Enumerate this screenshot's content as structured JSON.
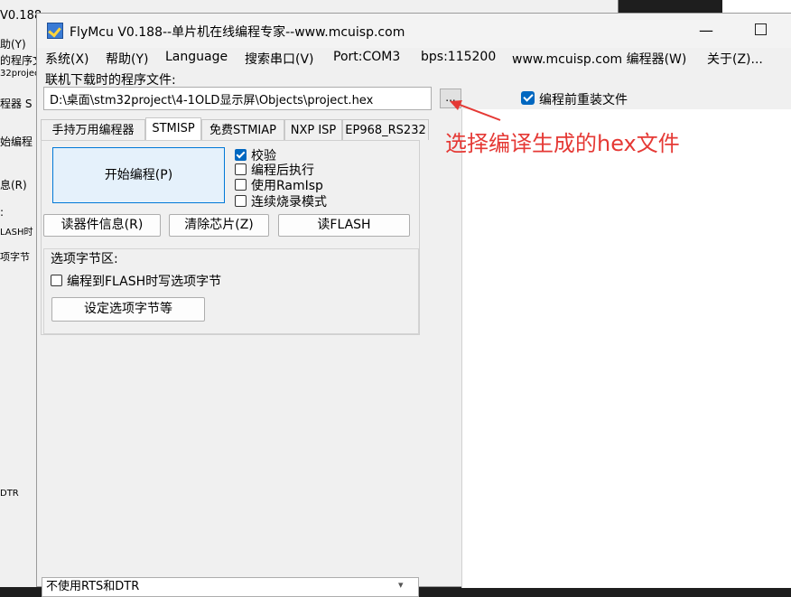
{
  "background_window": {
    "title": "V0.188-",
    "lines": [
      "助(Y)",
      "的程序文",
      "32projec",
      "程器 S",
      "始编程",
      "息(R)",
      ":",
      "LASH时",
      "项字节",
      "DTR"
    ]
  },
  "window": {
    "title": "FlyMcu V0.188--单片机在线编程专家--www.mcuisp.com",
    "minimize": "—"
  },
  "menu": [
    "系统(X)",
    "帮助(Y)",
    "Language",
    "搜索串口(V)",
    "Port:COM3",
    "bps:115200",
    "www.mcuisp.com 编程器(W)",
    "关于(Z)..."
  ],
  "file": {
    "label": "联机下载时的程序文件:",
    "path": "D:\\桌面\\stm32project\\4-1OLD显示屏\\Objects\\project.hex",
    "browse": "...",
    "reload_label": "编程前重装文件",
    "reload_checked": true
  },
  "tabs": [
    "手持万用编程器",
    "STMISP",
    "免费STMIAP",
    "NXP ISP",
    "EP968_RS232"
  ],
  "active_tab": "STMISP",
  "stmisp": {
    "start_button": "开始编程(P)",
    "options": [
      {
        "label": "校验",
        "checked": true
      },
      {
        "label": "编程后执行",
        "checked": false
      },
      {
        "label": "使用RamIsp",
        "checked": false
      },
      {
        "label": "连续烧录模式",
        "checked": false
      }
    ],
    "read_info": "读器件信息(R)",
    "erase_chip": "清除芯片(Z)",
    "read_flash": "读FLASH",
    "option_bytes": {
      "title": "选项字节区:",
      "write_on_program": "编程到FLASH时写选项字节",
      "write_checked": false,
      "settings_button": "设定选项字节等"
    }
  },
  "rts_dtr_select": "不使用RTS和DTR",
  "annotation": {
    "text": "选择编译生成的hex文件",
    "color": "#e53935"
  }
}
